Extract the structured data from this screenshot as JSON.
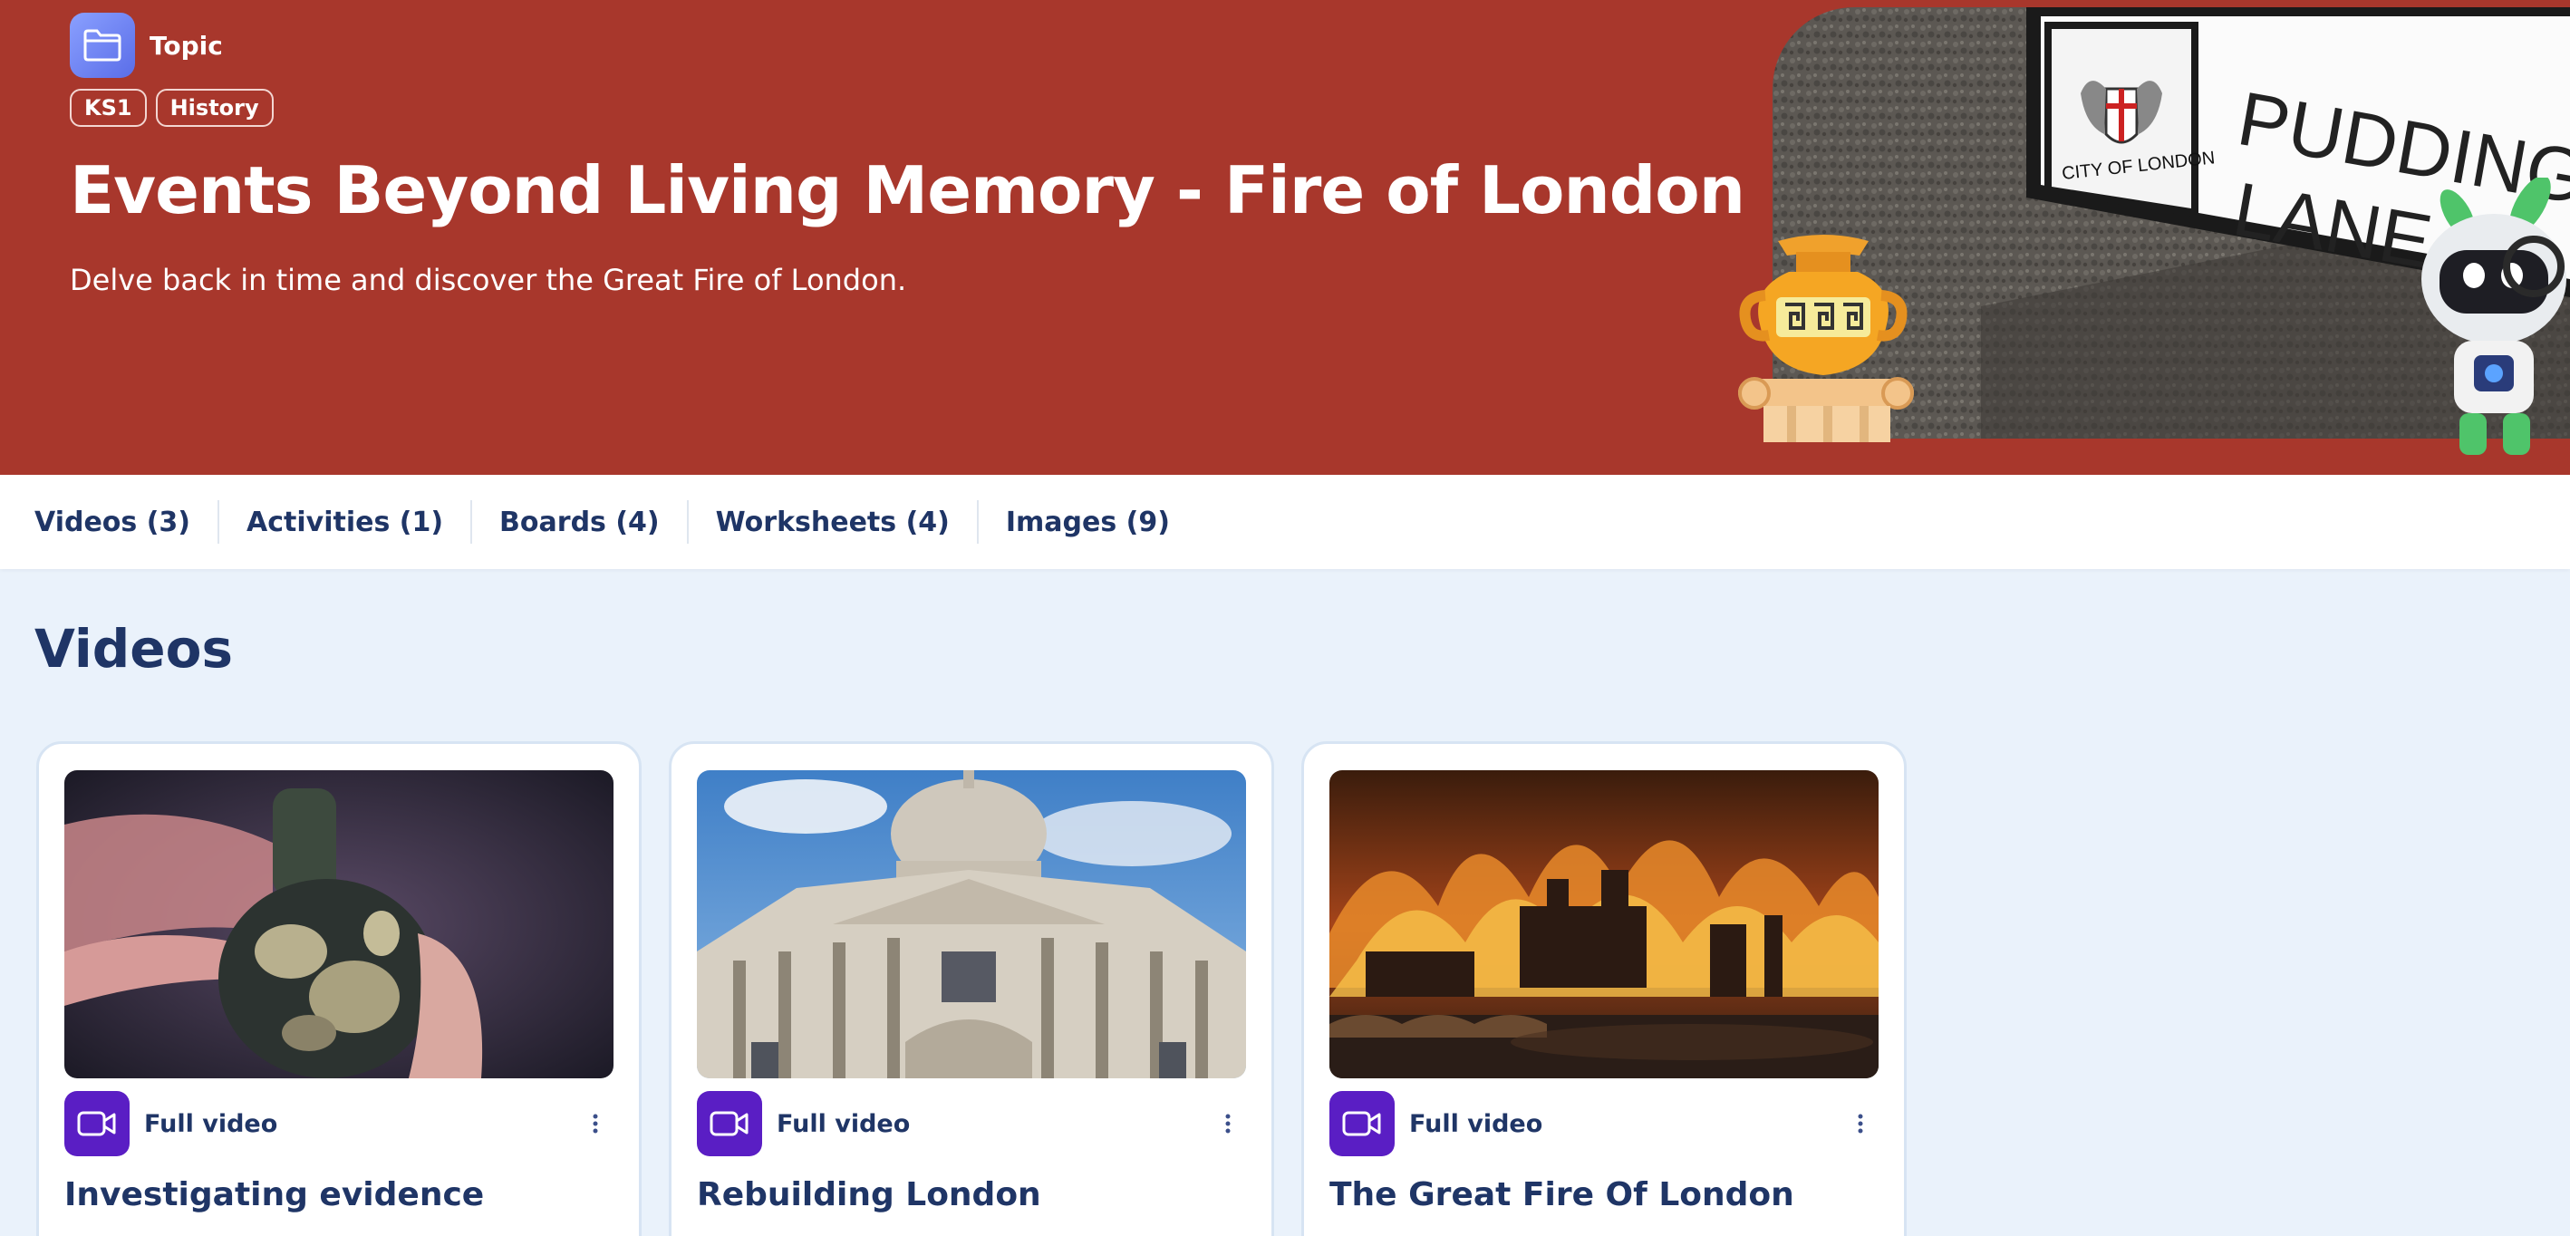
{
  "hero": {
    "topic_label": "Topic",
    "tags": [
      "KS1",
      "History"
    ],
    "title": "Events Beyond Living Memory - Fire of London",
    "subtitle": "Delve back in time and discover the Great Fire of London.",
    "photo": {
      "sign_line1": "PUDDING",
      "sign_line2": "LANE",
      "crest_text": "CITY OF LONDON"
    },
    "colors": {
      "background": "#a8372c",
      "topic_icon": "#6b7ff0"
    }
  },
  "tabs": [
    {
      "label": "Videos (3)"
    },
    {
      "label": "Activities (1)"
    },
    {
      "label": "Boards (4)"
    },
    {
      "label": "Worksheets (4)"
    },
    {
      "label": "Images (9)"
    }
  ],
  "videos_section": {
    "title": "Videos",
    "cards": [
      {
        "type_label": "Full video",
        "title": "Investigating evidence",
        "thumbnail": "glass-bottle-hands"
      },
      {
        "type_label": "Full video",
        "title": "Rebuilding London",
        "thumbnail": "st-pauls-cathedral"
      },
      {
        "type_label": "Full video",
        "title": "The Great Fire Of London",
        "thumbnail": "great-fire-painting"
      }
    ]
  },
  "colors": {
    "accent_video_icon": "#5a1ec4",
    "text_dark": "#1f3566",
    "page_bg": "#eaf2fb"
  }
}
